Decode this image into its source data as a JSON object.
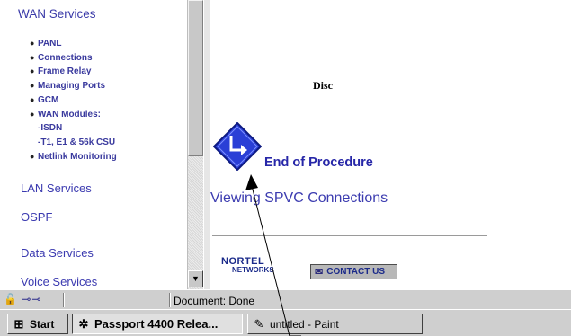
{
  "nav": {
    "wan_services": "WAN Services",
    "sub_items": [
      {
        "label": "PANL",
        "bullet": true
      },
      {
        "label": "Connections",
        "bullet": true
      },
      {
        "label": "Frame Relay",
        "bullet": true
      },
      {
        "label": "Managing Ports",
        "bullet": true
      },
      {
        "label": "GCM",
        "bullet": true
      },
      {
        "label": "WAN Modules:",
        "bullet": true
      },
      {
        "label": "-ISDN",
        "bullet": false
      },
      {
        "label": "-T1, E1 & 56k CSU",
        "bullet": false
      },
      {
        "label": "Netlink Monitoring",
        "bullet": true
      }
    ],
    "lan_services": "LAN Services",
    "ospf": "OSPF",
    "data_services": "Data Services",
    "voice_services": "Voice Services"
  },
  "scrollbar": {
    "down_arrow": "▼"
  },
  "content": {
    "disc": "Disc",
    "end_of_procedure": "End of Procedure",
    "viewing_link": "Viewing SPVC Connections",
    "logo_line1": "NORTEL",
    "logo_line2": "NETWORKS",
    "contact_us": "CONTACT US",
    "contact_icon": "envelope-icon"
  },
  "statusbar": {
    "icons": "lock-icon, connection-icon",
    "text": "Document: Done"
  },
  "taskbar": {
    "start": "Start",
    "passport": "Passport 4400 Relea...",
    "paint": "untitled - Paint"
  },
  "colors": {
    "link": "#3b3ab0",
    "eop_blue": "#2727a8",
    "icon_diamond": "#2a3fd6",
    "chrome": "#cfcfcf"
  }
}
